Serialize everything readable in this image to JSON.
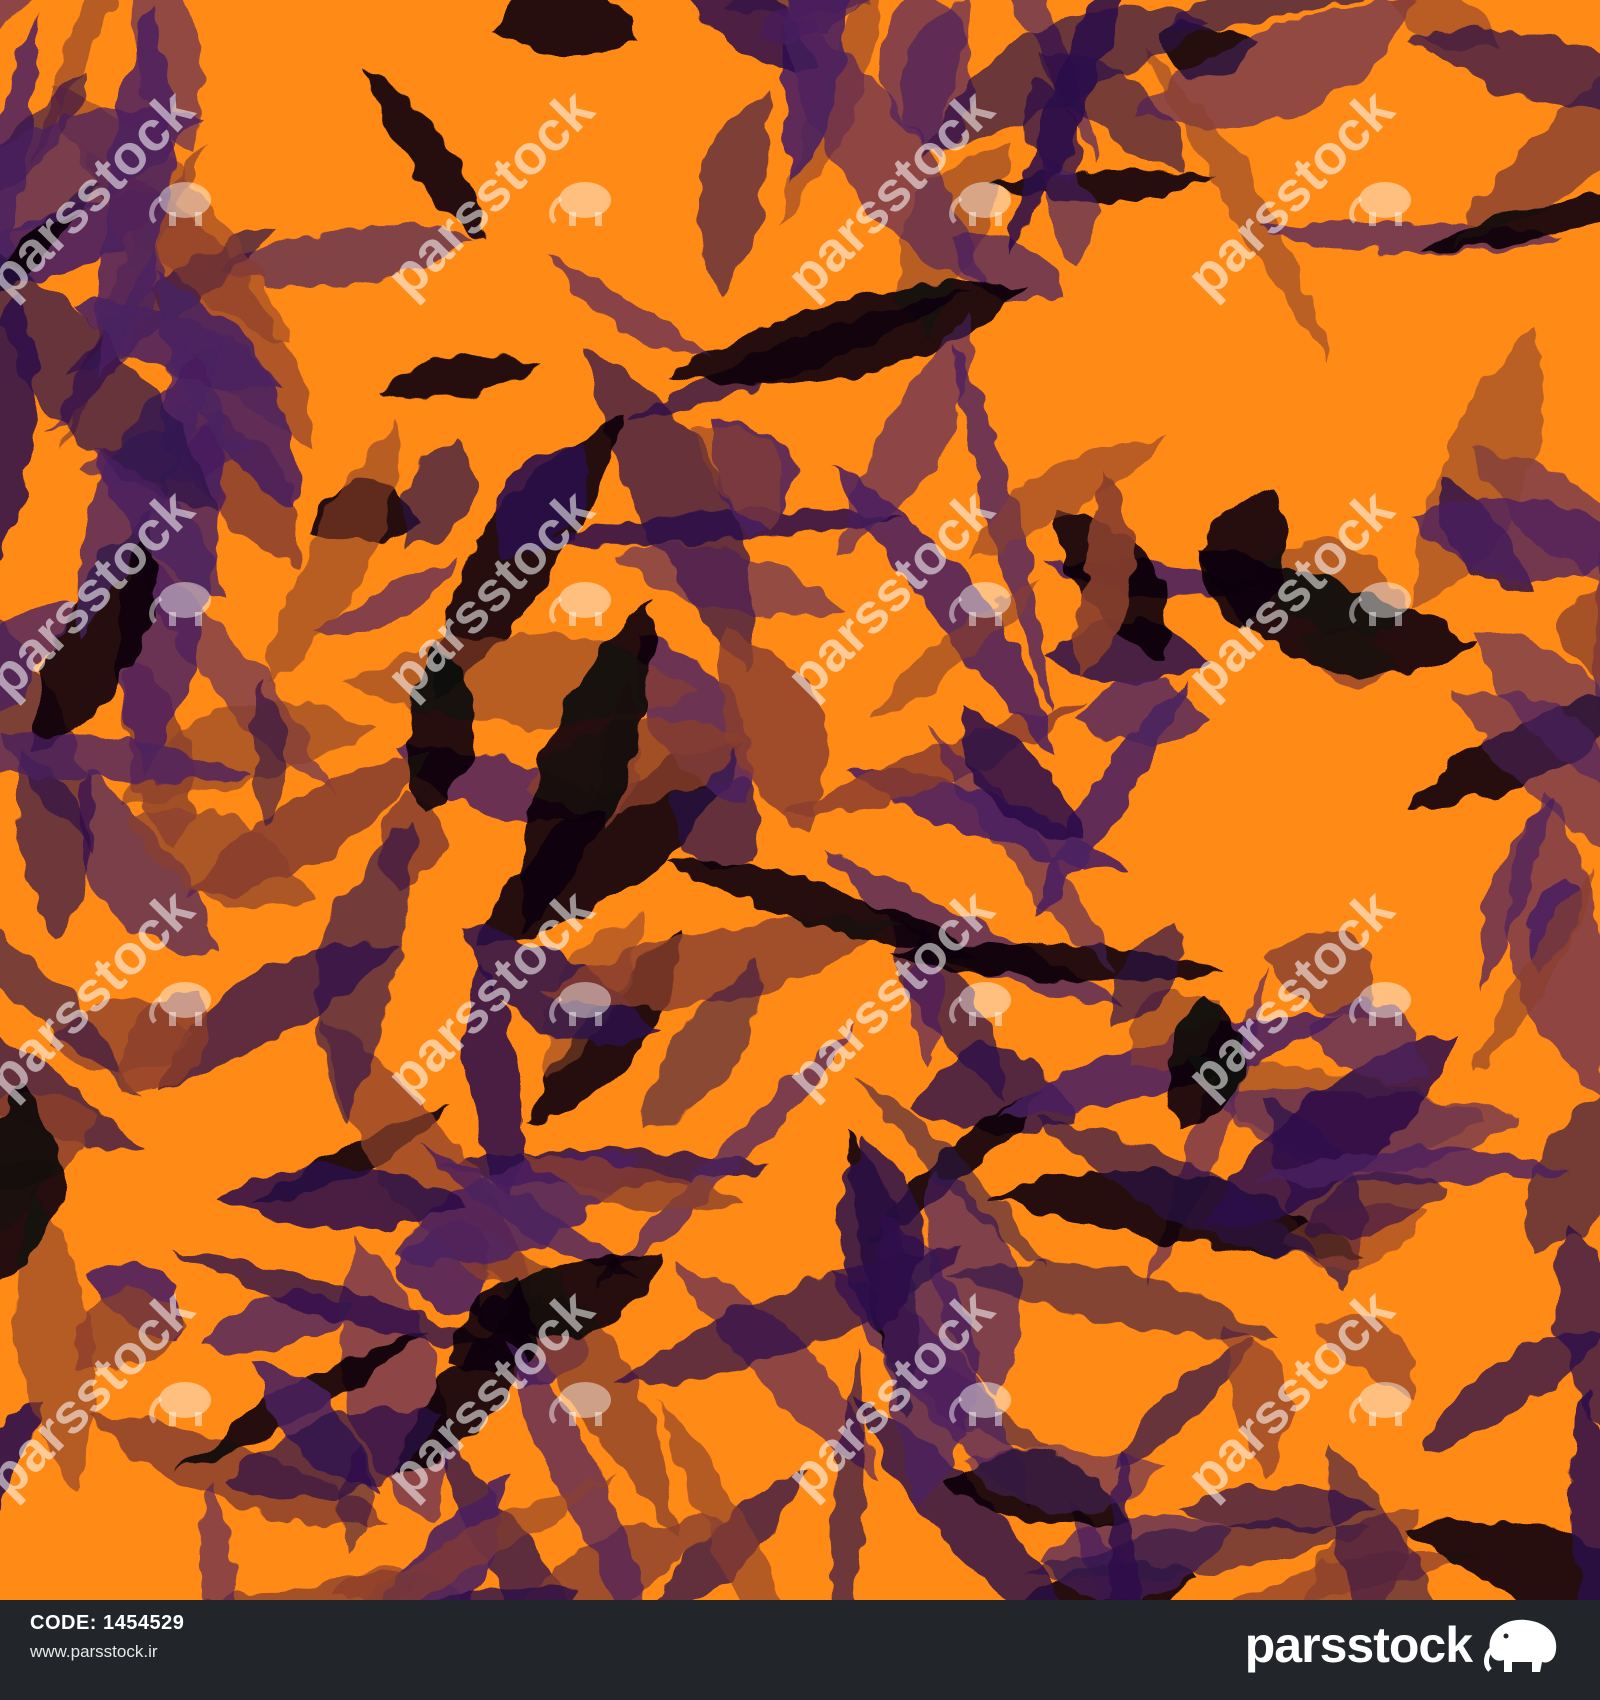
{
  "image": {
    "subject": "seamless abstract watercolor leaf camouflage pattern",
    "colors": {
      "background": "#ff8a16",
      "purple_dark": "#2c0f4a",
      "purple_mid": "#4a2060",
      "brown": "#8a3f2e",
      "black": "#0a0408"
    }
  },
  "watermark": {
    "text": "parsstock",
    "icon": "elephant-logo-icon"
  },
  "footer": {
    "code_label": "CODE:",
    "code_value": "1454529",
    "url": "www.parsstock.ir",
    "brand": "parsstock",
    "brand_icon": "elephant-logo-icon"
  }
}
